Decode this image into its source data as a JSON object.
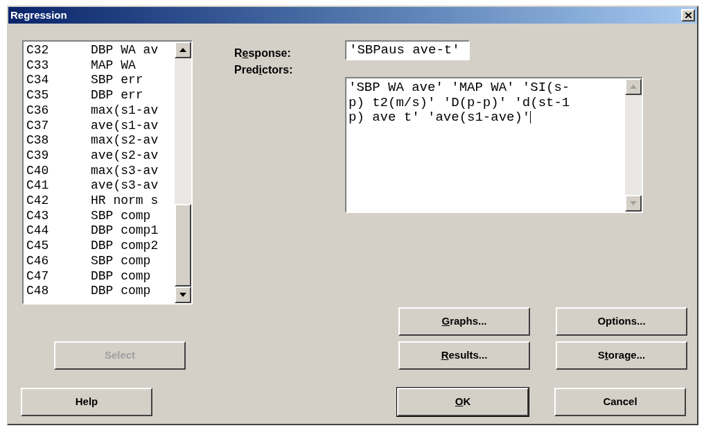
{
  "window": {
    "title": "Regression"
  },
  "columns_list": [
    {
      "id": "C32",
      "name": "DBP WA av"
    },
    {
      "id": "C33",
      "name": "MAP WA"
    },
    {
      "id": "C34",
      "name": "SBP err"
    },
    {
      "id": "C35",
      "name": "DBP err"
    },
    {
      "id": "C36",
      "name": "max(s1-av"
    },
    {
      "id": "C37",
      "name": "ave(s1-av"
    },
    {
      "id": "C38",
      "name": "max(s2-av"
    },
    {
      "id": "C39",
      "name": "ave(s2-av"
    },
    {
      "id": "C40",
      "name": "max(s3-av"
    },
    {
      "id": "C41",
      "name": "ave(s3-av"
    },
    {
      "id": "C42",
      "name": "HR norm s"
    },
    {
      "id": "C43",
      "name": "SBP comp"
    },
    {
      "id": "C44",
      "name": "DBP comp1"
    },
    {
      "id": "C45",
      "name": "DBP comp2"
    },
    {
      "id": "C46",
      "name": "SBP comp"
    },
    {
      "id": "C47",
      "name": "DBP comp"
    },
    {
      "id": "C48",
      "name": "DBP comp"
    }
  ],
  "response": {
    "label": {
      "before": "R",
      "key": "e",
      "after": "sponse:"
    },
    "value": "'SBPaus ave-t'"
  },
  "predictors": {
    "label": {
      "before": "Pred",
      "key": "i",
      "after": "ctors:"
    },
    "value": "'SBP WA ave' 'MAP WA' 'SI(s-p) t2(m/s)' 'D(p-p)' 'd(st-1p) ave t' 'ave(s1-ave)'"
  },
  "select_button": {
    "label": {
      "before": "Select"
    },
    "disabled": true
  },
  "help_button": {
    "label": {
      "before": "Help"
    }
  },
  "buttons": [
    {
      "label": {
        "key": "G",
        "after": "raphs..."
      },
      "default": false
    },
    {
      "label": {
        "after": "Options..."
      },
      "default": false
    },
    {
      "label": {
        "key": "R",
        "after": "esults..."
      },
      "default": false
    },
    {
      "label": {
        "before": "S",
        "key": "t",
        "after": "orage..."
      },
      "default": false
    },
    {
      "label": {
        "key": "O",
        "after": "K"
      },
      "default": true
    },
    {
      "label": {
        "after": "Cancel"
      },
      "default": false
    }
  ]
}
